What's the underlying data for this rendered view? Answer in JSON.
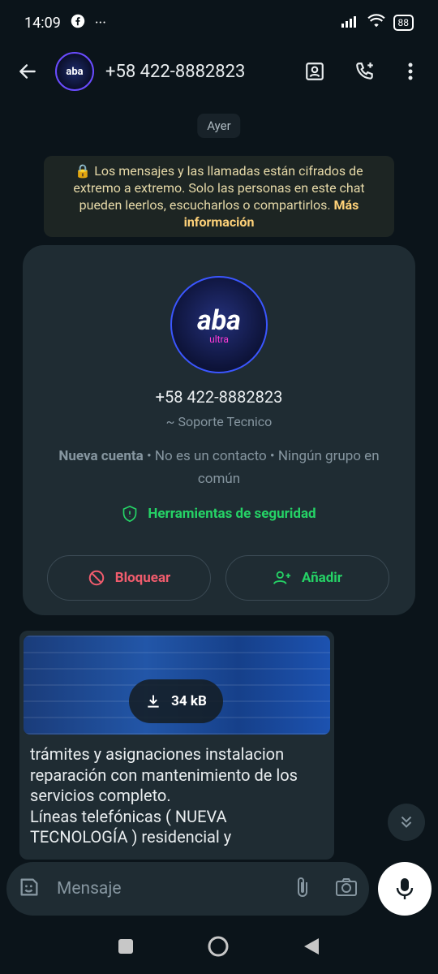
{
  "status": {
    "time": "14:09",
    "battery": "88",
    "more": "···"
  },
  "header": {
    "avatar_text": "aba",
    "title": "+58 422-8882823"
  },
  "chat": {
    "date": "Ayer",
    "encryption": {
      "text": "🔒 Los mensajes y las llamadas están cifrados de extremo a extremo. Solo las personas en este chat pueden leerlos, escucharlos o compartirlos. ",
      "link": "Más información"
    },
    "contact_card": {
      "logo": "aba",
      "logo_sub": "ultra",
      "phone": "+58 422-8882823",
      "name": "~ Soporte Tecnico",
      "info_bold": "Nueva cuenta",
      "info_rest": " • No es un contacto • Ningún grupo en común",
      "security": "Herramientas de seguridad",
      "block": "Bloquear",
      "add": "Añadir"
    },
    "message": {
      "size": "34 kB",
      "text": "trámites y asignaciones instalacion reparación con mantenimiento de los servicios completo.\nLíneas telefónicas ( NUEVA TECNOLOGÍA ) residencial y"
    }
  },
  "composer": {
    "placeholder": "Mensaje"
  },
  "colors": {
    "background": "#0b141a",
    "bubble": "#1f2c33",
    "accent_green": "#25d366",
    "danger_red": "#f15c6d"
  }
}
